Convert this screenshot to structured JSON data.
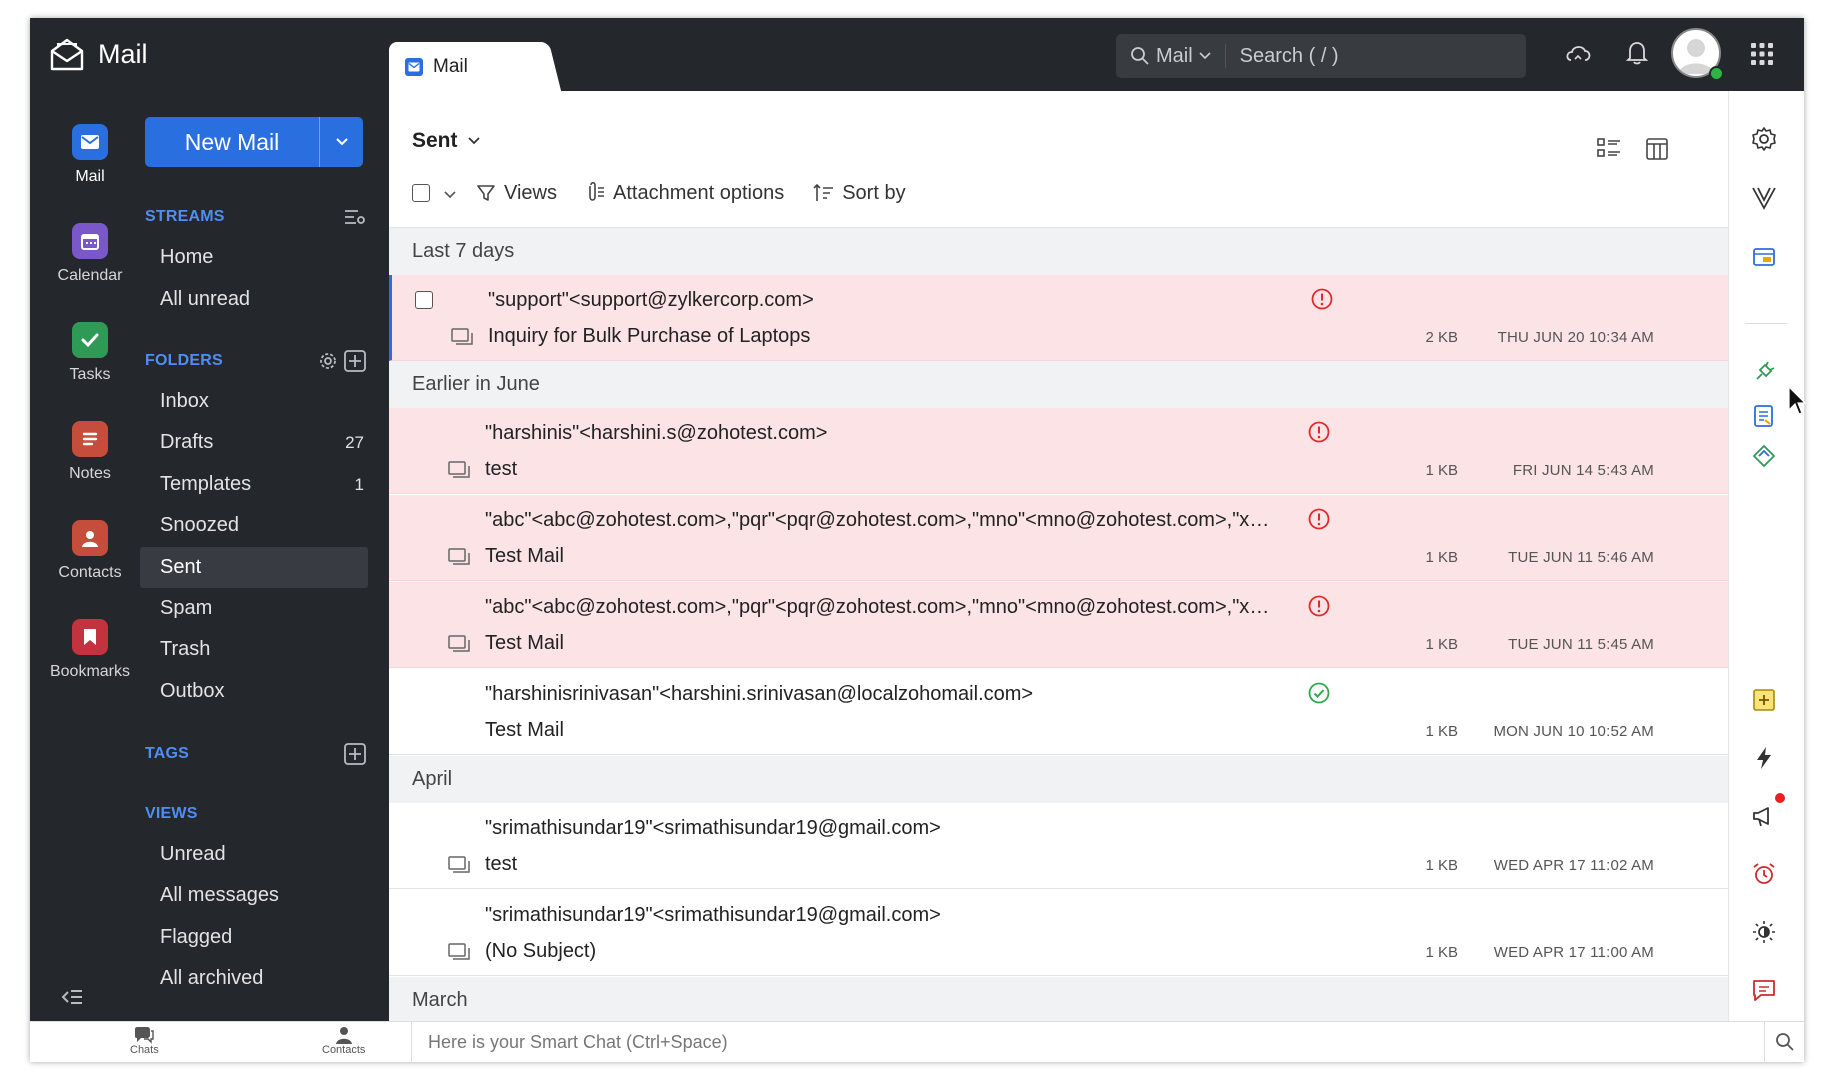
{
  "app": {
    "name": "Mail"
  },
  "rail": [
    {
      "label": "Mail",
      "icon": "mail-icon",
      "color": "#2a6fe0",
      "active": true
    },
    {
      "label": "Calendar",
      "icon": "calendar-icon",
      "color": "#7a58c9"
    },
    {
      "label": "Tasks",
      "icon": "tasks-icon",
      "color": "#2f9a56"
    },
    {
      "label": "Notes",
      "icon": "notes-icon",
      "color": "#c64d3b"
    },
    {
      "label": "Contacts",
      "icon": "contacts-icon",
      "color": "#c64d3b"
    },
    {
      "label": "Bookmarks",
      "icon": "bookmarks-icon",
      "color": "#c2323f"
    }
  ],
  "new_mail": {
    "label": "New Mail"
  },
  "streams": {
    "heading": "STREAMS",
    "items": [
      "Home",
      "All unread"
    ]
  },
  "folders": {
    "heading": "FOLDERS",
    "items": [
      {
        "label": "Inbox",
        "count": ""
      },
      {
        "label": "Drafts",
        "count": "27"
      },
      {
        "label": "Templates",
        "count": "1"
      },
      {
        "label": "Snoozed",
        "count": ""
      },
      {
        "label": "Sent",
        "count": "",
        "active": true
      },
      {
        "label": "Spam",
        "count": ""
      },
      {
        "label": "Trash",
        "count": ""
      },
      {
        "label": "Outbox",
        "count": ""
      }
    ]
  },
  "tags": {
    "heading": "TAGS"
  },
  "views": {
    "heading": "VIEWS",
    "items": [
      "Unread",
      "All messages",
      "Flagged",
      "All archived"
    ]
  },
  "tab": {
    "label": "Mail"
  },
  "search": {
    "scope": "Mail",
    "placeholder": "Search ( / )"
  },
  "folder_title": "Sent",
  "toolbar": {
    "views": "Views",
    "attachment": "Attachment options",
    "sort": "Sort by"
  },
  "groups": [
    "Last 7 days",
    "Earlier in June",
    "April",
    "March"
  ],
  "messages": [
    {
      "sender": "\"support\"<support@zylkercorp.com>",
      "subject": "Inquiry for Bulk Purchase of Laptops",
      "size": "2 KB",
      "date": "THU JUN 20 10:34 AM",
      "status": "error",
      "pink": true,
      "selected": true
    },
    {
      "sender": "\"harshinis\"<harshini.s@zohotest.com>",
      "subject": "test",
      "size": "1 KB",
      "date": "FRI JUN 14 5:43 AM",
      "status": "error",
      "pink": true
    },
    {
      "sender": "\"abc\"<abc@zohotest.com>,\"pqr\"<pqr@zohotest.com>,\"mno\"<mno@zohotest.com>,\"xyz\"<xyz@zohotest.com>",
      "subject": "Test Mail",
      "size": "1 KB",
      "date": "TUE JUN 11 5:46 AM",
      "status": "error",
      "pink": true
    },
    {
      "sender": "\"abc\"<abc@zohotest.com>,\"pqr\"<pqr@zohotest.com>,\"mno\"<mno@zohotest.com>,\"xyz\"<xyz@zohotest.com>",
      "subject": "Test Mail",
      "size": "1 KB",
      "date": "TUE JUN 11 5:45 AM",
      "status": "error",
      "pink": true
    },
    {
      "sender": "\"harshinisrinivasan\"<harshini.srinivasan@localzohomail.com>",
      "subject": "Test Mail",
      "size": "1 KB",
      "date": "MON JUN 10 10:52 AM",
      "status": "ok",
      "pink": false
    },
    {
      "sender": "\"srimathisundar19\"<srimathisundar19@gmail.com>",
      "subject": "test",
      "size": "1 KB",
      "date": "WED APR 17 11:02 AM",
      "status": "",
      "pink": false
    },
    {
      "sender": "\"srimathisundar19\"<srimathisundar19@gmail.com>",
      "subject": "(No Subject)",
      "size": "1 KB",
      "date": "WED APR 17 11:00 AM",
      "status": "",
      "pink": false
    }
  ],
  "bottom": {
    "chats": "Chats",
    "contacts": "Contacts",
    "smart_chat": "Here is your Smart Chat (Ctrl+Space)"
  },
  "colors": {
    "dark": "#24272b",
    "accent": "#2a6fe0",
    "error": "#e02b2b",
    "ok": "#2fa84f",
    "pink_row": "#fbe3e6"
  }
}
